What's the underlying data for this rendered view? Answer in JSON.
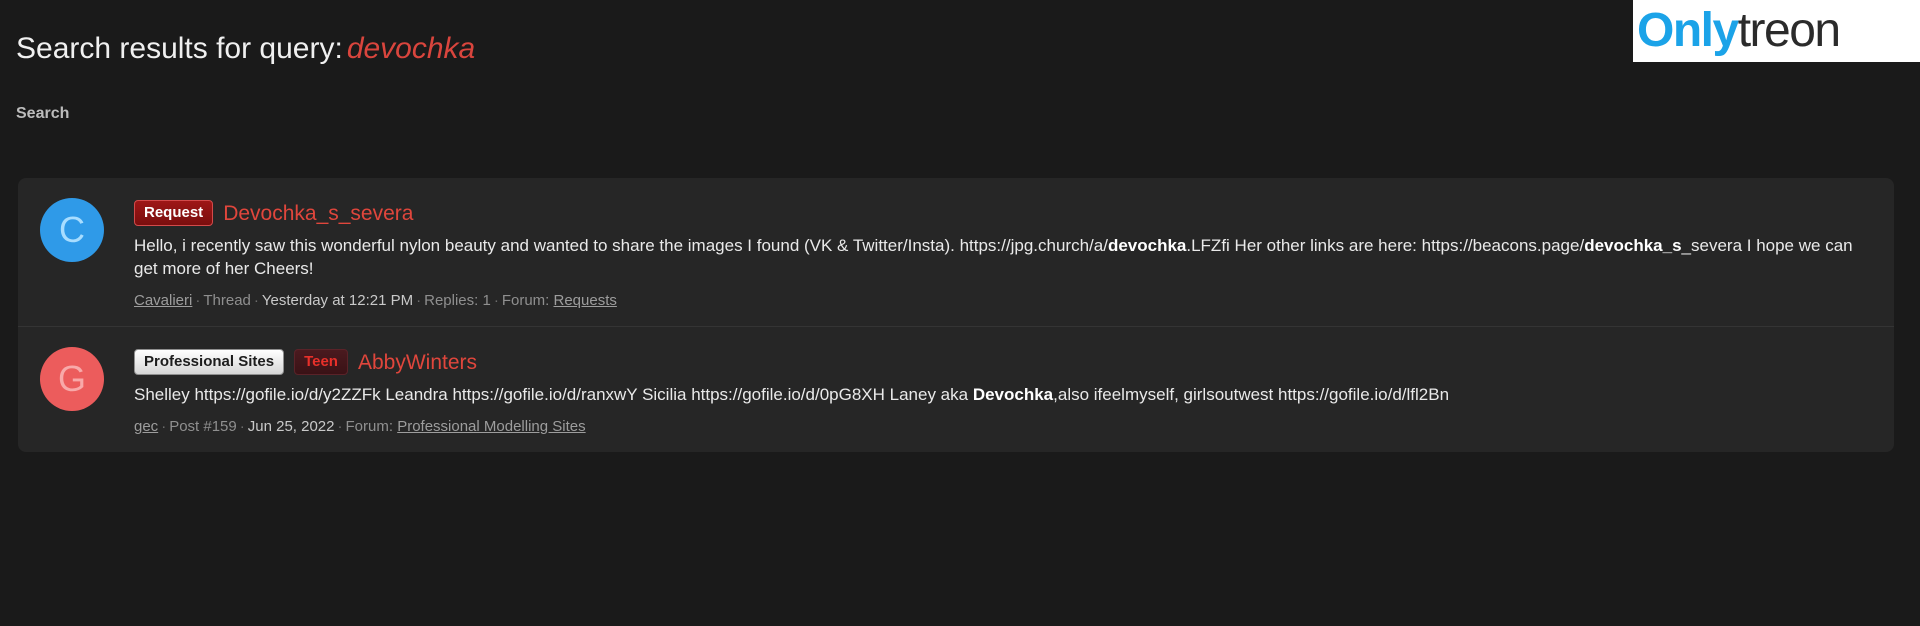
{
  "header": {
    "title_prefix": "Search results for query:",
    "query": "devochka"
  },
  "logo": {
    "part_blue": "Only",
    "part_dark": "treon",
    "color_blue": "#1ba3e8",
    "color_dark": "#2b2b2b"
  },
  "breadcrumb": {
    "label": "Search"
  },
  "results": [
    {
      "avatar_letter": "C",
      "avatar_color": "#2f9ae8",
      "badges": [
        {
          "label": "Request",
          "style": "request"
        }
      ],
      "title": "Devochka_s_severa",
      "snippet_parts": [
        {
          "text": "Hello, i recently saw this wonderful nylon beauty and wanted to share the images I found (VK & Twitter/Insta). https://jpg.church/a/",
          "bold": false
        },
        {
          "text": "devochka",
          "bold": true
        },
        {
          "text": ".LFZfi Her other links are here: https://beacons.page/",
          "bold": false
        },
        {
          "text": "devochka_s",
          "bold": true
        },
        {
          "text": "_severa I hope we can get more of her Cheers!",
          "bold": false
        }
      ],
      "meta": {
        "author": "Cavalieri",
        "type": "Thread",
        "date": "Yesterday at 12:21 PM",
        "replies_label": "Replies: 1",
        "forum_label": "Forum:",
        "forum": "Requests"
      }
    },
    {
      "avatar_letter": "G",
      "avatar_color": "#ec5c5c",
      "badges": [
        {
          "label": "Professional Sites",
          "style": "prosites"
        },
        {
          "label": "Teen",
          "style": "teen"
        }
      ],
      "title": "AbbyWinters",
      "snippet_parts": [
        {
          "text": "Shelley https://gofile.io/d/y2ZZFk Leandra https://gofile.io/d/ranxwY Sicilia https://gofile.io/d/0pG8XH Laney aka ",
          "bold": false
        },
        {
          "text": "Devochka",
          "bold": true
        },
        {
          "text": ",also ifeelmyself, girlsoutwest https://gofile.io/d/lfl2Bn",
          "bold": false
        }
      ],
      "meta": {
        "author": "gec",
        "type": "Post #159",
        "date": "Jun 25, 2022",
        "replies_label": "",
        "forum_label": "Forum:",
        "forum": "Professional Modelling Sites"
      }
    }
  ]
}
